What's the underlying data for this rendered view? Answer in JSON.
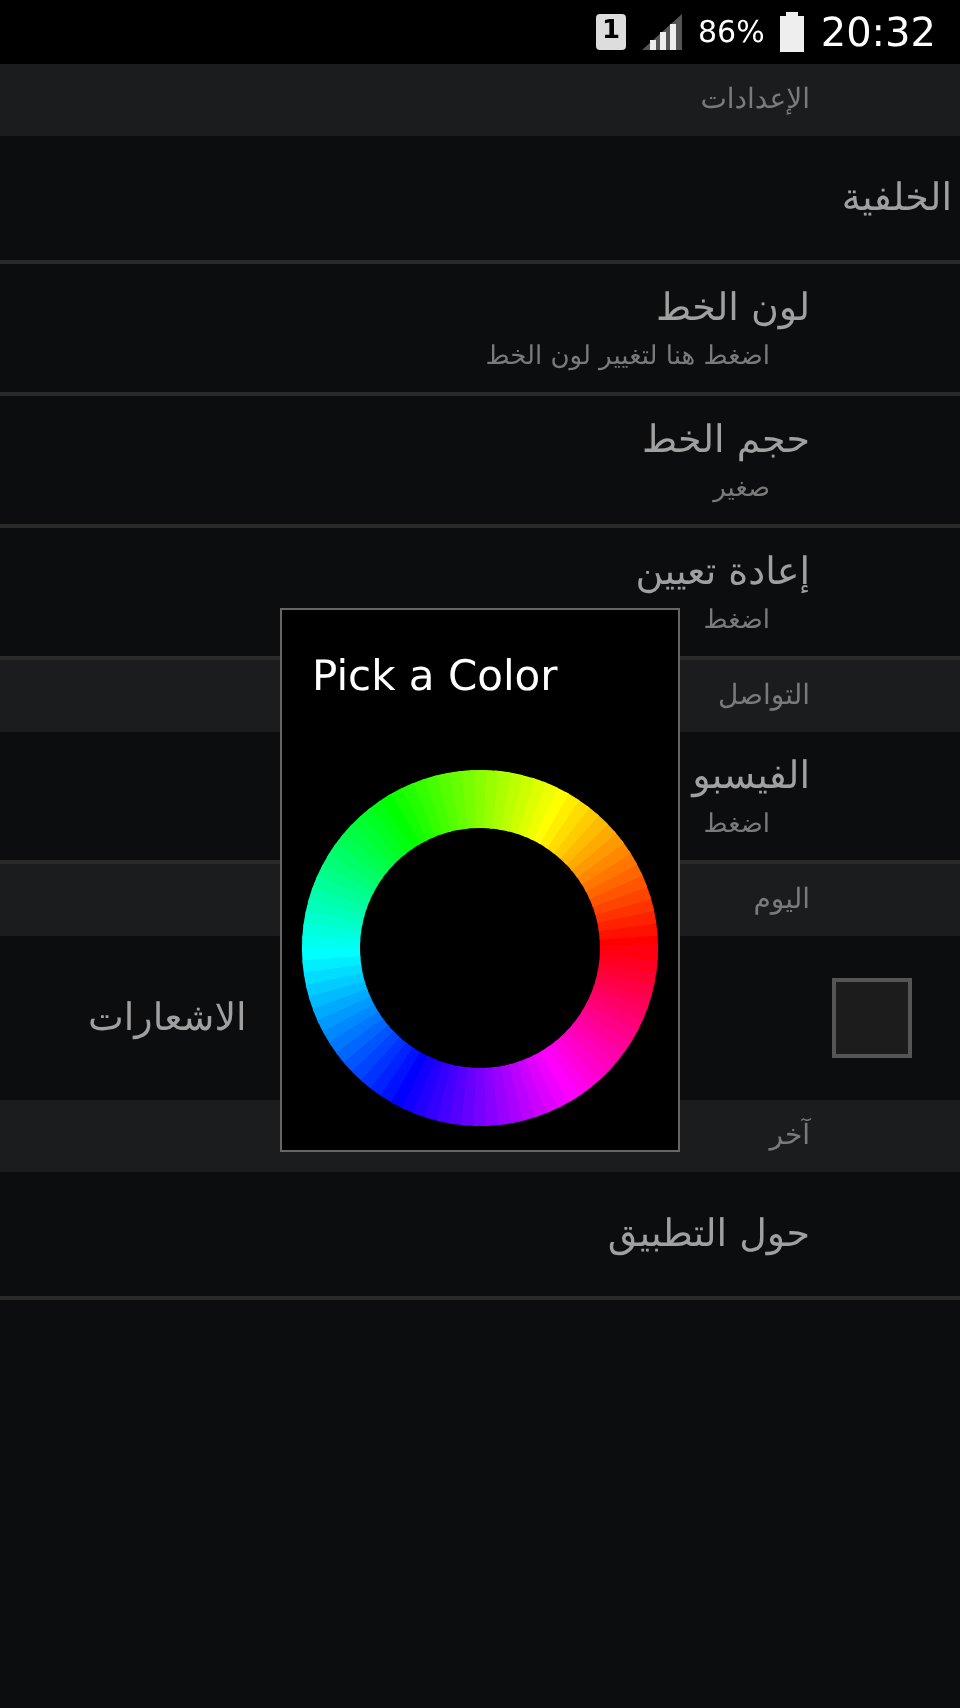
{
  "status_bar": {
    "sim": "1",
    "battery": "86%",
    "time": "20:32"
  },
  "sections": [
    {
      "kind": "header",
      "title": "الإعدادات"
    },
    {
      "kind": "item",
      "title": "الخلفية",
      "edge": true
    },
    {
      "kind": "item",
      "title": "لون الخط",
      "subtitle": "اضغط هنا لتغيير لون الخط"
    },
    {
      "kind": "item",
      "title": "حجم الخط",
      "subtitle": "صغير"
    },
    {
      "kind": "item",
      "title": "إعادة تعيين",
      "subtitle": "اضغط"
    },
    {
      "kind": "header",
      "title": "التواصل"
    },
    {
      "kind": "item",
      "title": "الفيسبو",
      "subtitle": "اضغط"
    },
    {
      "kind": "header",
      "title": "اليوم"
    },
    {
      "kind": "check",
      "title": "الاشعارات",
      "checked": false
    },
    {
      "kind": "header",
      "title": "آخر"
    },
    {
      "kind": "item",
      "title": "حول التطبيق"
    }
  ],
  "dialog": {
    "title": "Pick a Color"
  }
}
